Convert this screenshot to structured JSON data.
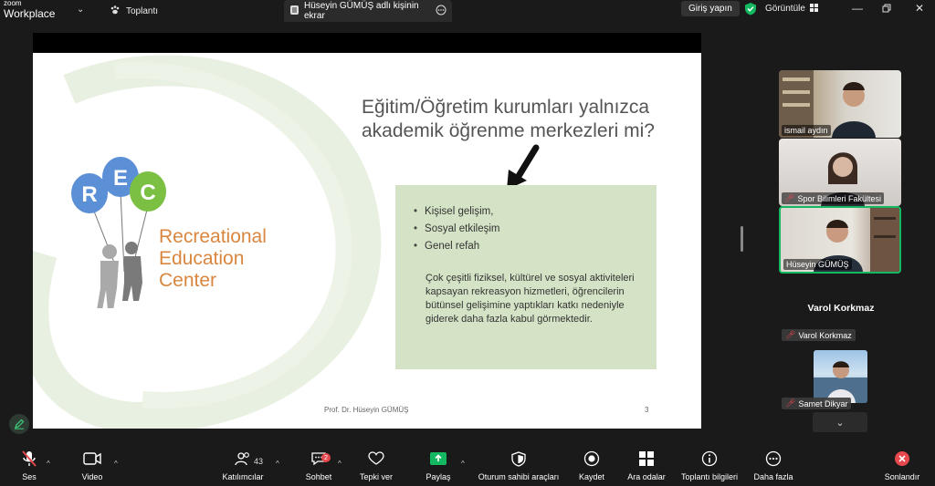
{
  "titlebar": {
    "brand_line1": "zoom",
    "brand_line2": "Workplace",
    "meeting_label": "Toplantı",
    "share_tab": "Hüseyin GÜMÜŞ adlı kişinin ekrar",
    "signin": "Giriş yapın",
    "view": "Görüntüle"
  },
  "slide": {
    "title_line1": "Eğitim/Öğretim kurumları yalnızca",
    "title_line2": "akademik öğrenme merkezleri mi?",
    "bullets": [
      "Kişisel gelişim,",
      "Sosyal etkileşim",
      "Genel refah"
    ],
    "paragraph": "Çok çeşitli fiziksel, kültürel ve sosyal aktiviteleri kapsayan rekreasyon hizmetleri, öğrencilerin bütünsel gelişimine yaptıkları katkı nedeniyle giderek daha fazla kabul görmektedir.",
    "logo_letters": [
      "R",
      "E",
      "C"
    ],
    "logo_line1": "Recreational",
    "logo_line2": "Education",
    "logo_line3": "Center",
    "footer": "Prof. Dr. Hüseyin GÜMÜŞ",
    "page_number": "3"
  },
  "participants": {
    "tiles": [
      {
        "name": "ismail aydın",
        "muted": false
      },
      {
        "name": "Spor Bilimleri Fakültesi",
        "muted": true
      },
      {
        "name": "Hüseyin GÜMÜŞ",
        "muted": false
      }
    ],
    "heading": "Varol Korkmaz",
    "label_varol": "Varol Korkmaz",
    "label_samet": "Samet Dikyar"
  },
  "toolbar": {
    "audio": "Ses",
    "video": "Video",
    "participants": "Katılımcılar",
    "participants_count": "43",
    "chat": "Sohbet",
    "chat_badge": "2",
    "reactions": "Tepki ver",
    "share": "Paylaş",
    "host_tools": "Oturum sahibi araçları",
    "record": "Kaydet",
    "breakout": "Ara odalar",
    "info": "Toplantı bilgileri",
    "more": "Daha fazla",
    "end": "Sonlandır"
  },
  "colors": {
    "accent_green": "#14b860",
    "end_red": "#e5484d",
    "slide_box": "#d4e3c5",
    "logo_orange": "#d9863f"
  }
}
